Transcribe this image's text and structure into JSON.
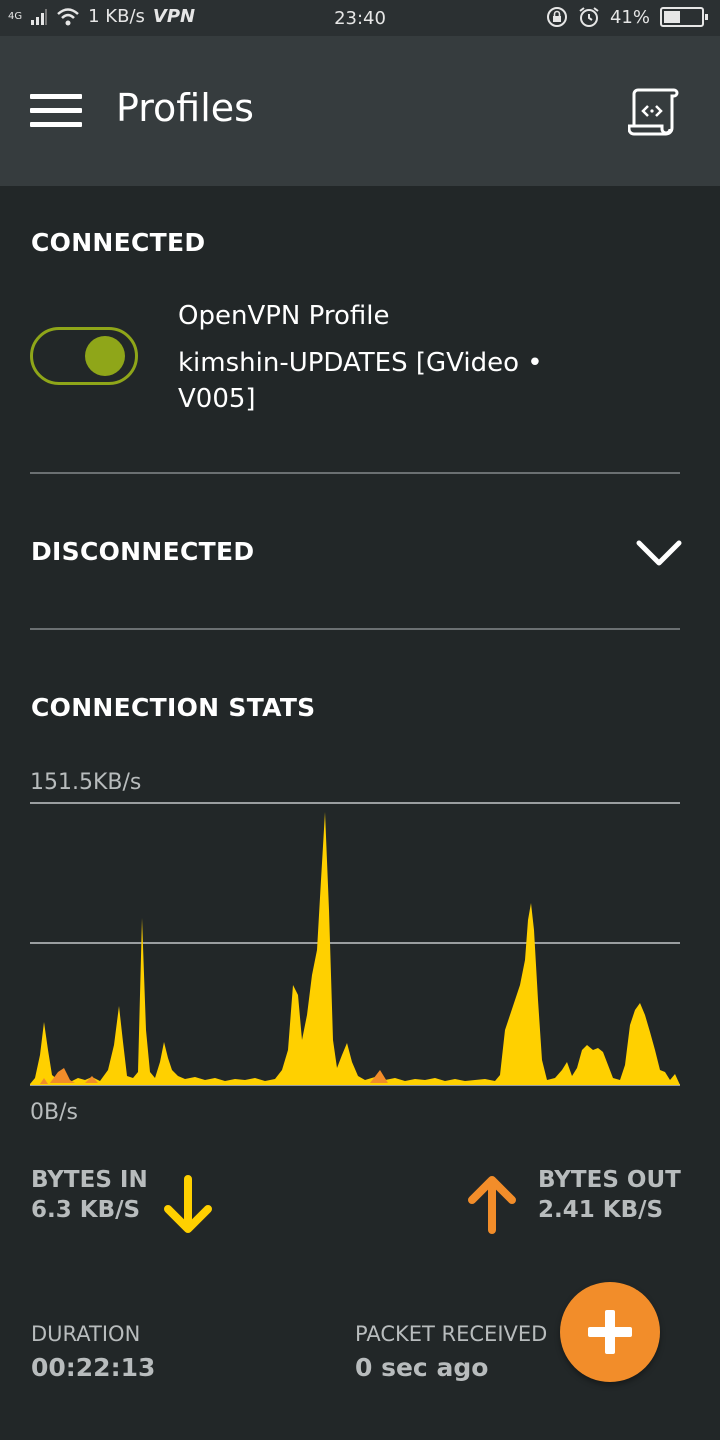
{
  "status_bar": {
    "network": "4G",
    "speed": "1 KB/s",
    "vpn": "VPN",
    "time": "23:40",
    "battery": "41%"
  },
  "appbar": {
    "title": "Profiles",
    "menu_icon": "hamburger-menu-icon",
    "import_icon": "import-profile-icon"
  },
  "connected": {
    "header": "CONNECTED",
    "profile_name": "OpenVPN Profile",
    "profile_server": "kimshin-UPDATES [GVideo • V005]",
    "toggle_on": true,
    "toggle_color": "#8fa619"
  },
  "disconnected": {
    "header": "DISCONNECTED",
    "expand_icon": "chevron-down-icon"
  },
  "stats": {
    "header": "CONNECTION STATS",
    "graph_max": "151.5KB/s",
    "graph_min": "0B/s",
    "bytes_in_label": "BYTES IN",
    "bytes_in_value": "6.3 KB/S",
    "bytes_in_color": "#ffd000",
    "bytes_out_label": "BYTES OUT",
    "bytes_out_value": "2.41 KB/S",
    "bytes_out_color": "#f28d2a",
    "duration_label": "DURATION",
    "duration_value": "00:22:13",
    "packet_label": "PACKET RECEIVED",
    "packet_value": "0 sec ago"
  },
  "fab": {
    "icon": "plus-icon",
    "color": "#f28d2a"
  }
}
